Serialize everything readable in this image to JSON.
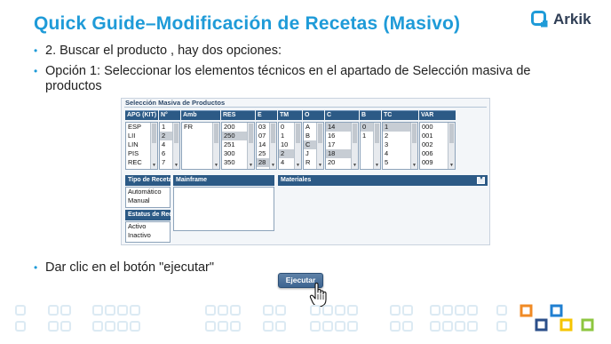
{
  "header": {
    "title": "Quick Guide–Modificación de Recetas (Masivo)",
    "brand": "Arkik",
    "brand_color": "#1f9bd8"
  },
  "bullets": [
    {
      "text": "2. Buscar el producto , hay dos opciones:"
    },
    {
      "text": "Opción 1: Seleccionar los elementos técnicos en el apartado de Selección masiva de productos"
    },
    {
      "text": "Dar clic en el botón \"ejecutar\""
    }
  ],
  "panel": {
    "title": "Selección Masiva de Productos",
    "columns": [
      {
        "header": "APG (KIT)",
        "options": [
          "ESP",
          "LII",
          "LIN",
          "PIS",
          "REC"
        ],
        "selected": []
      },
      {
        "header": "N°",
        "options": [
          "1",
          "2",
          "4",
          "6",
          "7"
        ],
        "selected": [
          1
        ]
      },
      {
        "header": "Amb",
        "options": [
          "",
          "FR",
          "",
          "",
          ""
        ],
        "selected": []
      },
      {
        "header": "RES",
        "options": [
          "200",
          "250",
          "251",
          "300",
          "350"
        ],
        "selected": [
          1
        ]
      },
      {
        "header": "E",
        "options": [
          "03",
          "07",
          "14",
          "25",
          "28"
        ],
        "selected": [
          4
        ]
      },
      {
        "header": "TM",
        "options": [
          "0",
          "1",
          "10",
          "2",
          "4"
        ],
        "selected": [
          3
        ]
      },
      {
        "header": "O",
        "options": [
          "A",
          "B",
          "C",
          "J",
          "R"
        ],
        "selected": [
          2
        ]
      },
      {
        "header": "C",
        "options": [
          "14",
          "16",
          "17",
          "18",
          "20"
        ],
        "selected": [
          0,
          3
        ]
      },
      {
        "header": "B",
        "options": [
          "0",
          "1",
          "",
          "",
          ""
        ],
        "selected": [
          0
        ]
      },
      {
        "header": "TC",
        "options": [
          "1",
          "2",
          "3",
          "4",
          "5"
        ],
        "selected": [
          0
        ]
      },
      {
        "header": "VAR",
        "options": [
          "000",
          "001",
          "002",
          "006",
          "009"
        ],
        "selected": []
      }
    ],
    "tipo_receta": {
      "header": "Tipo de Receta",
      "options": [
        "Automático",
        "Manual"
      ]
    },
    "estatus_receta": {
      "header": "Estatus de Recet",
      "options": [
        "Activo",
        "Inactivo"
      ]
    },
    "mainframe": {
      "header": "Mainframe"
    },
    "materiales": {
      "header": "Materiales"
    }
  },
  "actions": {
    "execute_label": "Ejecutar"
  }
}
